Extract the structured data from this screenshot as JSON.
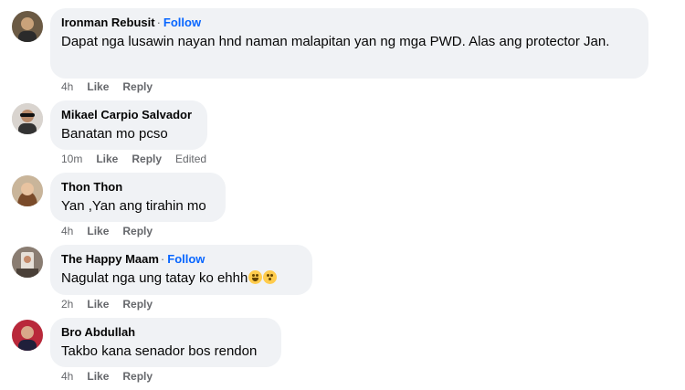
{
  "comments": [
    {
      "author": "Ironman Rebusit",
      "follow": "Follow",
      "text": "Dapat nga lusawin nayan hnd naman malapitan yan ng mga PWD. Alas ang protector Jan.",
      "time": "4h",
      "like": "Like",
      "reply": "Reply",
      "avatar_icon": "avatar-photo"
    },
    {
      "author": "Mikael Carpio Salvador",
      "text": "Banatan mo pcso",
      "time": "10m",
      "like": "Like",
      "reply": "Reply",
      "edited": "Edited",
      "avatar_icon": "avatar-photo"
    },
    {
      "author": "Thon Thon",
      "text": "Yan ,Yan ang tirahin mo",
      "time": "4h",
      "like": "Like",
      "reply": "Reply",
      "avatar_icon": "avatar-photo"
    },
    {
      "author": "The Happy Maam",
      "follow": "Follow",
      "text": "Nagulat nga ung tatay ko ehhh",
      "emojis": [
        "laughing-tears-emoji",
        "flushed-face-emoji"
      ],
      "time": "2h",
      "like": "Like",
      "reply": "Reply",
      "avatar_icon": "avatar-photo"
    },
    {
      "author": "Bro Abdullah",
      "text": "Takbo kana senador bos rendon",
      "time": "4h",
      "like": "Like",
      "reply": "Reply",
      "avatar_icon": "avatar-photo"
    }
  ],
  "colors": {
    "bubble": "#f0f2f5",
    "follow": "#0866ff",
    "meta": "#65676b",
    "text": "#050505"
  }
}
